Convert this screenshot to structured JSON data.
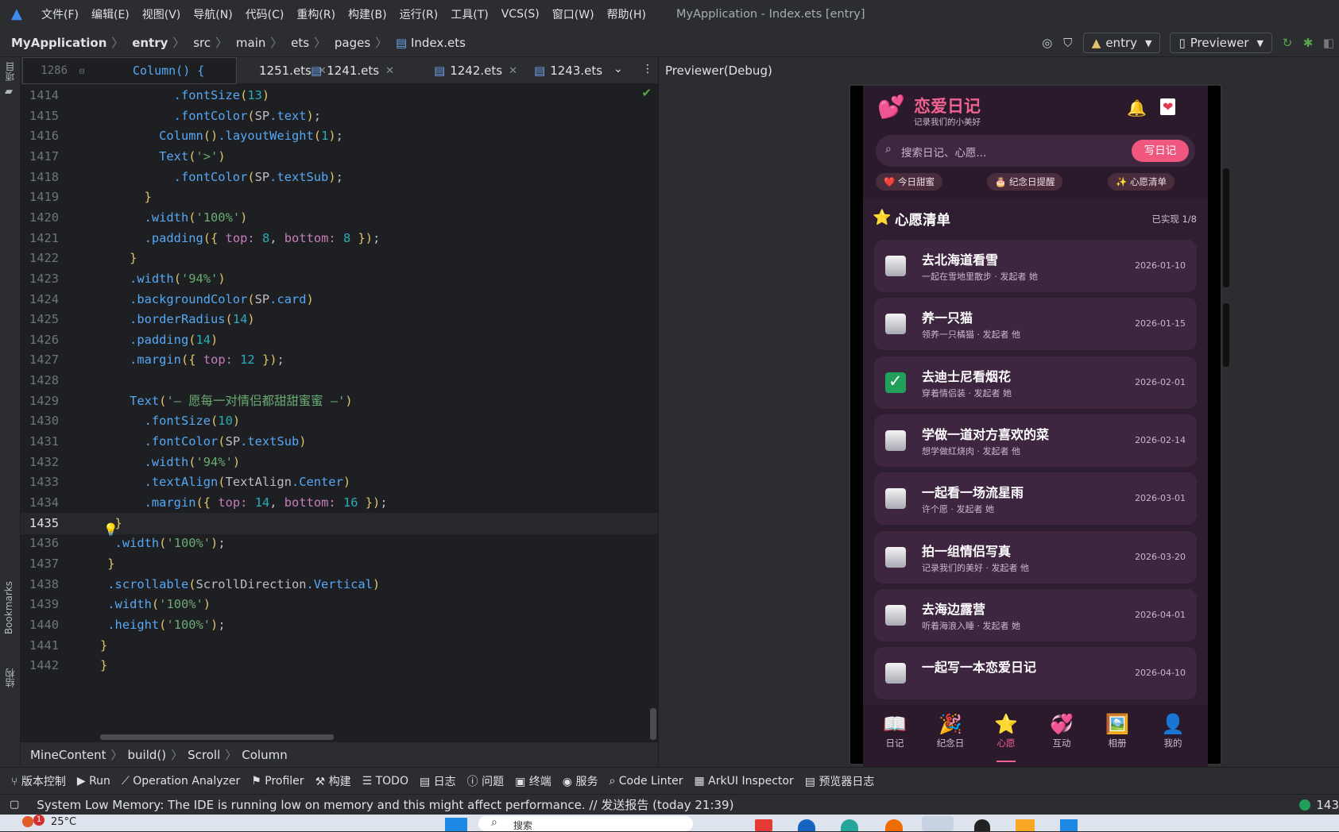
{
  "menubar": {
    "items": [
      "文件(F)",
      "编辑(E)",
      "视图(V)",
      "导航(N)",
      "代码(C)",
      "重构(R)",
      "构建(B)",
      "运行(R)",
      "工具(T)",
      "VCS(S)",
      "窗口(W)",
      "帮助(H)"
    ],
    "window_title": "MyApplication - Index.ets [entry]"
  },
  "breadcrumb": {
    "project": "MyApplication",
    "items": [
      "entry",
      "src",
      "main",
      "ets",
      "pages",
      "Index.ets"
    ]
  },
  "toolbar": {
    "module": "entry",
    "run_target": "Previewer"
  },
  "left_strip": {
    "project": "项目",
    "bookmarks": "Bookmarks",
    "structure": "结构"
  },
  "editor": {
    "sticky_line_number": "1286",
    "sticky_code": "Column() {",
    "tabs": [
      "1251.ets",
      "1241.ets",
      "1242.ets",
      "1243.ets"
    ],
    "lines": [
      {
        "n": "1414",
        "code": "          .fontSize(13)"
      },
      {
        "n": "1415",
        "code": "          .fontColor(SP.text);"
      },
      {
        "n": "1416",
        "code": "        Column().layoutWeight(1);"
      },
      {
        "n": "1417",
        "code": "        Text('>')"
      },
      {
        "n": "1418",
        "code": "          .fontColor(SP.textSub);"
      },
      {
        "n": "1419",
        "code": "      }"
      },
      {
        "n": "1420",
        "code": "      .width('100%')"
      },
      {
        "n": "1421",
        "code": "      .padding({ top: 8, bottom: 8 });"
      },
      {
        "n": "1422",
        "code": "    }"
      },
      {
        "n": "1423",
        "code": "    .width('94%')"
      },
      {
        "n": "1424",
        "code": "    .backgroundColor(SP.card)"
      },
      {
        "n": "1425",
        "code": "    .borderRadius(14)"
      },
      {
        "n": "1426",
        "code": "    .padding(14)"
      },
      {
        "n": "1427",
        "code": "    .margin({ top: 12 });"
      },
      {
        "n": "1428",
        "code": ""
      },
      {
        "n": "1429",
        "code": "    Text('— 愿每一对情侣都甜甜蜜蜜 —')"
      },
      {
        "n": "1430",
        "code": "      .fontSize(10)"
      },
      {
        "n": "1431",
        "code": "      .fontColor(SP.textSub)"
      },
      {
        "n": "1432",
        "code": "      .width('94%')"
      },
      {
        "n": "1433",
        "code": "      .textAlign(TextAlign.Center)"
      },
      {
        "n": "1434",
        "code": "      .margin({ top: 14, bottom: 16 });"
      },
      {
        "n": "1435",
        "code": "  }"
      },
      {
        "n": "1436",
        "code": "  .width('100%');"
      },
      {
        "n": "1437",
        "code": " }"
      },
      {
        "n": "1438",
        "code": " .scrollable(ScrollDirection.Vertical)"
      },
      {
        "n": "1439",
        "code": " .width('100%')"
      },
      {
        "n": "1440",
        "code": " .height('100%');"
      },
      {
        "n": "1441",
        "code": "}"
      },
      {
        "n": "1442",
        "code": "}"
      }
    ],
    "current_line": "1435",
    "structure_path": [
      "MineContent",
      "build()",
      "Scroll",
      "Column"
    ]
  },
  "previewer": {
    "title": "Previewer(Debug)",
    "app": {
      "title": "恋爱日记",
      "subtitle": "记录我们的小美好",
      "search_placeholder": "搜索日记、心愿...",
      "write_button": "写日记",
      "chips": [
        "❤️ 今日甜蜜",
        "🎂 纪念日提醒",
        "✨ 心愿清单"
      ],
      "section_title": "心愿清单",
      "section_count": "已实现 1/8",
      "wishes": [
        {
          "title": "去北海道看雪",
          "sub": "一起在雪地里散步 · 发起者 她",
          "date": "2026-01-10",
          "done": false
        },
        {
          "title": "养一只猫",
          "sub": "领养一只橘猫 · 发起者 他",
          "date": "2026-01-15",
          "done": false
        },
        {
          "title": "去迪士尼看烟花",
          "sub": "穿着情侣装 · 发起者 她",
          "date": "2026-02-01",
          "done": true
        },
        {
          "title": "学做一道对方喜欢的菜",
          "sub": "想学做红烧肉 · 发起者 他",
          "date": "2026-02-14",
          "done": false
        },
        {
          "title": "一起看一场流星雨",
          "sub": "许个愿 · 发起者 她",
          "date": "2026-03-01",
          "done": false
        },
        {
          "title": "拍一组情侣写真",
          "sub": "记录我们的美好 · 发起者 他",
          "date": "2026-03-20",
          "done": false
        },
        {
          "title": "去海边露营",
          "sub": "听着海浪入睡 · 发起者 她",
          "date": "2026-04-01",
          "done": false
        },
        {
          "title": "一起写一本恋爱日记",
          "sub": "",
          "date": "2026-04-10",
          "done": false
        }
      ],
      "tabs": [
        {
          "icon": "📖",
          "label": "日记"
        },
        {
          "icon": "🎉",
          "label": "纪念日"
        },
        {
          "icon": "⭐",
          "label": "心愿"
        },
        {
          "icon": "💞",
          "label": "互动"
        },
        {
          "icon": "🖼️",
          "label": "相册"
        },
        {
          "icon": "👤",
          "label": "我的"
        }
      ],
      "active_tab": "心愿"
    }
  },
  "tool_windows": [
    "版本控制",
    "Run",
    "Operation Analyzer",
    "Profiler",
    "构建",
    "TODO",
    "日志",
    "问题",
    "终端",
    "服务",
    "Code Linter",
    "ArkUI Inspector",
    "预览器日志"
  ],
  "status": {
    "message": "System Low Memory: The IDE is running low on memory and this might affect performance. // 发送报告 (today 21:39)",
    "right": "143"
  },
  "taskbar": {
    "weather": "25°C",
    "notification_count": "1",
    "search": "搜索"
  },
  "colors": {
    "accent": "#f06292",
    "write_button": "#f0577f",
    "done_check": "#20a05a"
  }
}
